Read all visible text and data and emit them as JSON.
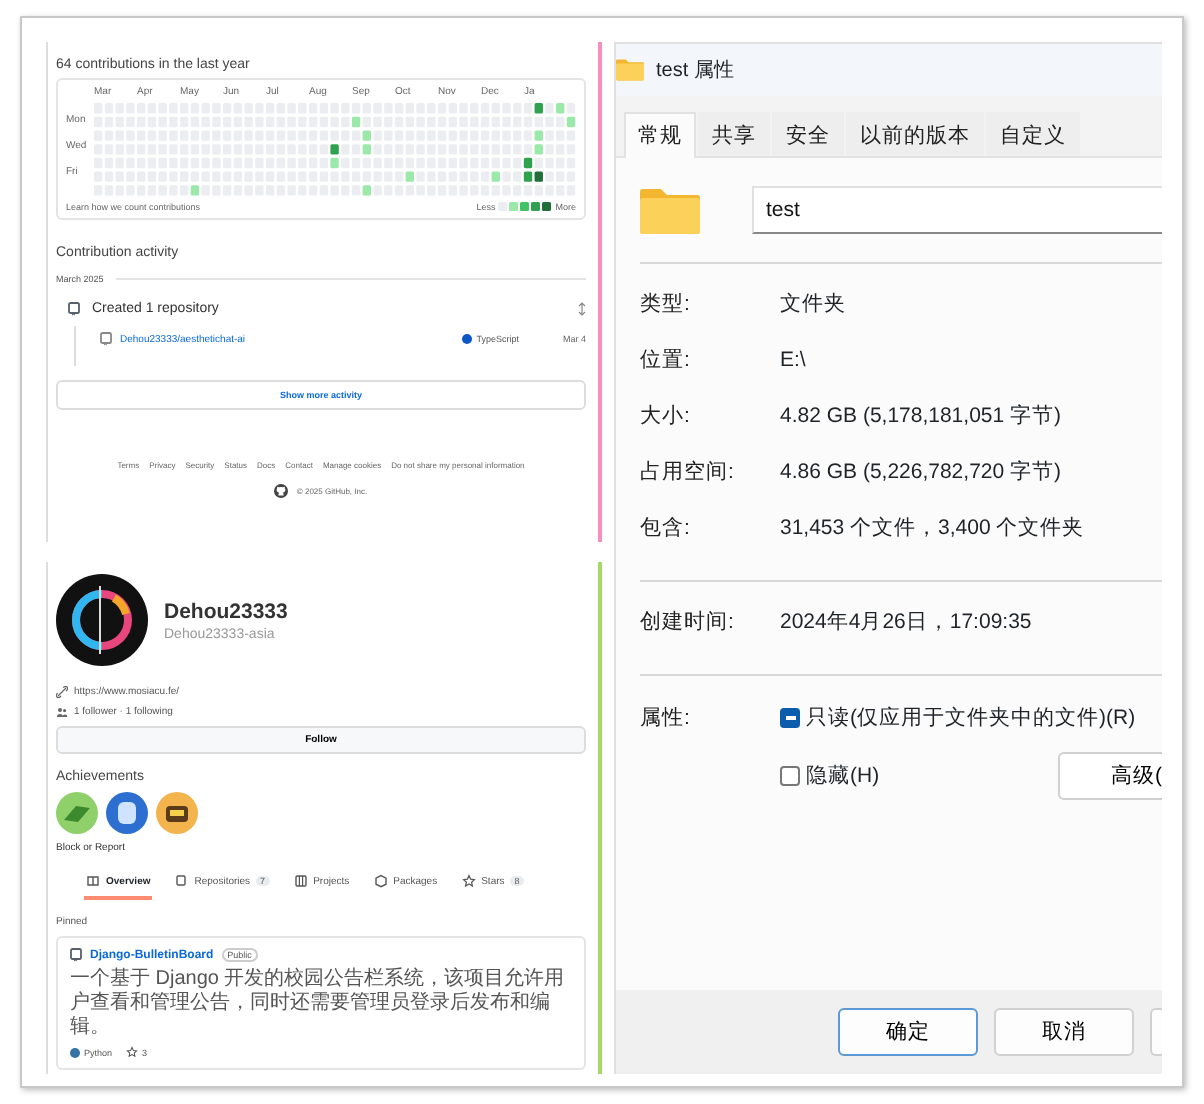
{
  "contributions": {
    "title": "64 contributions in the last year",
    "months": [
      "Mar",
      "Apr",
      "May",
      "Jun",
      "Jul",
      "Aug",
      "Sep",
      "Oct",
      "Nov",
      "Dec",
      "Ja"
    ],
    "weekdays": [
      "Mon",
      "Wed",
      "Fri"
    ],
    "learn_link": "Learn how we count contributions",
    "legend_less": "Less",
    "legend_more": "More"
  },
  "activity": {
    "title": "Contribution activity",
    "month": "March 2025",
    "event": "Created 1 repository",
    "repo": "Dehou23333/aesthetichat-ai",
    "language": "TypeScript",
    "date": "Mar 4",
    "show_more": "Show more activity"
  },
  "footer": {
    "links": [
      "Terms",
      "Privacy",
      "Security",
      "Status",
      "Docs",
      "Contact",
      "Manage cookies",
      "Do not share my personal information"
    ],
    "copyright": "© 2025 GitHub, Inc."
  },
  "profile": {
    "name": "Dehou23333",
    "username": "Dehou23333-asia",
    "website": "https://www.mosiacu.fe/",
    "followers": "1 follower · 1 following",
    "follow_button": "Follow",
    "achievements_title": "Achievements",
    "block_link": "Block or Report"
  },
  "tabs": [
    {
      "label": "Overview",
      "selected": true
    },
    {
      "label": "Repositories",
      "count": "7",
      "selected": false
    },
    {
      "label": "Projects",
      "selected": false
    },
    {
      "label": "Packages",
      "selected": false
    },
    {
      "label": "Stars",
      "count": "8",
      "selected": false
    }
  ],
  "pinned": {
    "title": "Pinned",
    "repo": "Django-BulletinBoard",
    "visibility": "Public",
    "description": "一个基于 Django 开发的校园公告栏系统，该项目允许用户查看和管理公告，同时还需要管理员登录后发布和编辑。",
    "language": "Python",
    "stars": "3"
  },
  "properties_window": {
    "title": "test 属性",
    "tabs": [
      {
        "label": "常规",
        "selected": true
      },
      {
        "label": "共享",
        "selected": false
      },
      {
        "label": "安全",
        "selected": false
      },
      {
        "label": "以前的版本",
        "selected": false
      },
      {
        "label": "自定义",
        "selected": false
      }
    ],
    "name_value": "test",
    "info_groups": [
      [
        {
          "label": "类型:",
          "value": "文件夹"
        },
        {
          "label": "位置:",
          "value": "E:\\"
        },
        {
          "label": "大小:",
          "value": "4.82 GB (5,178,181,051 字节)"
        },
        {
          "label": "占用空间:",
          "value": "4.86 GB (5,226,782,720 字节)"
        },
        {
          "label": "包含:",
          "value": "31,453 个文件，3,400 个文件夹"
        }
      ],
      [
        {
          "label": "创建时间:",
          "value": "2024年4月26日，17:09:35"
        }
      ]
    ],
    "attributes_label": "属性:",
    "attributes": [
      {
        "label": "只读(仅应用于文件夹中的文件)(R)",
        "checked": true,
        "indeterminate": true
      },
      {
        "label": "隐藏(H)",
        "checked": false,
        "indeterminate": false
      }
    ],
    "advanced_button": "高级(",
    "buttons": [
      {
        "label": "确定",
        "focused": true
      },
      {
        "label": "取消",
        "focused": false
      }
    ]
  }
}
